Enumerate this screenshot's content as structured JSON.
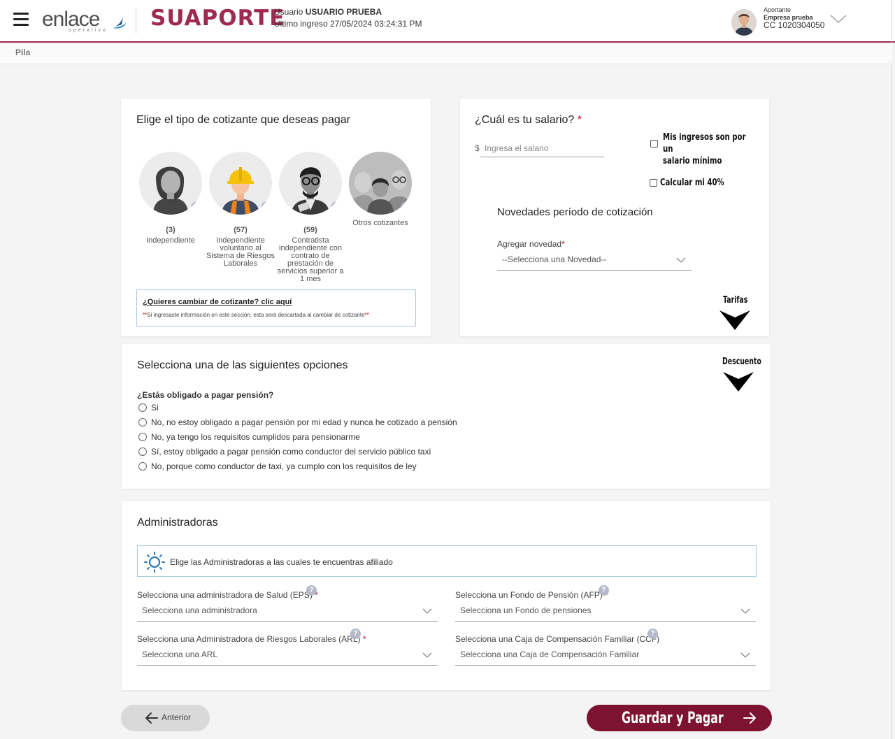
{
  "header": {
    "brand_primary": "enlace",
    "brand_sub": "operativo",
    "brand_secondary": "SUAPORTE",
    "user_prefix": "Usuario",
    "user_name": "USUARIO PRUEBA",
    "last_login": "Último ingreso 27/05/2024 03:24:31 PM",
    "role": "Aportante",
    "company": "Empresa prueba",
    "document": "CC 1020304050",
    "accent_color": "#9e2a4f"
  },
  "breadcrumb": {
    "current": "Pila"
  },
  "cotizante": {
    "title": "Elige el tipo de cotizante que deseas pagar",
    "types": [
      {
        "count": "(3)",
        "label": "Independiente",
        "icon": "woman-avatar-icon"
      },
      {
        "count": "(57)",
        "label": "Independiente voluntario al Sistema de Riesgos Laborales",
        "icon": "worker-hardhat-icon"
      },
      {
        "count": "(59)",
        "label": "Contratista independiente con contrato de prestación de servicios superior a 1 mes",
        "icon": "contractor-glasses-icon"
      },
      {
        "count": "",
        "label": "Otros cotizantes",
        "icon": "group-people-icon"
      }
    ],
    "help_glyph": "?",
    "change_link": "¿Quieres cambiar de cotizante? clic aquí",
    "change_note_mark": "**",
    "change_note": "Si ingresaste información en este sección, esta será descartada al cambiar de cotizante",
    "change_note_end": "**"
  },
  "salario": {
    "title": "¿Cuál es tu salario?",
    "required_mark": "*",
    "currency": "$",
    "placeholder": "Ingresa el salario",
    "min_wage_label_1": "Mis ingresos son por un",
    "min_wage_label_2": "salario mínimo",
    "calc40_label": "Calcular mi 40%",
    "novedades_title": "Novedades período de cotización",
    "novedad_label": "Agregar novedad",
    "novedad_select": "--Selecciona una Novedad--",
    "tarifas_label": "Tarifas"
  },
  "opciones": {
    "title": "Selecciona una de las siguientes opciones",
    "descuento_label": "Descuento",
    "question": "¿Estás obligado a pagar pensión?",
    "options": [
      "Si",
      "No, no estoy obligado a pagar pensión por mi edad y nunca he cotizado a pensión",
      "No, ya tengo los requisitos cumplidos para pensionarme",
      "Sí, estoy obligado a pagar pensión como conductor del servicio público taxi",
      "No, porque como conductor de taxi, ya cumplo con los requisitos de ley"
    ]
  },
  "administradoras": {
    "title": "Administradoras",
    "info": "Elige las Administradoras a las cuales te encuentras afiliado",
    "eps_label": "Selecciona una administradora de Salud (EPS)",
    "eps_select": "Selecciona una administradora",
    "afp_label": "Selecciona un Fondo de Pensión (AFP)",
    "afp_select": "Selecciona un Fondo de pensiones",
    "arl_label": "Selecciona una Administradora de Riesgos Laborales (ARL)",
    "arl_select": "Selecciona una ARL",
    "ccf_label": "Selecciona una Caja de Compensación Familiar (CCF)",
    "ccf_select": "Selecciona una Caja de Compensación Familiar",
    "required_mark": "*",
    "help_glyph": "?"
  },
  "footer": {
    "prev_label": "Anterior",
    "save_label": "Guardar y Pagar",
    "save_color": "#7d1331"
  }
}
